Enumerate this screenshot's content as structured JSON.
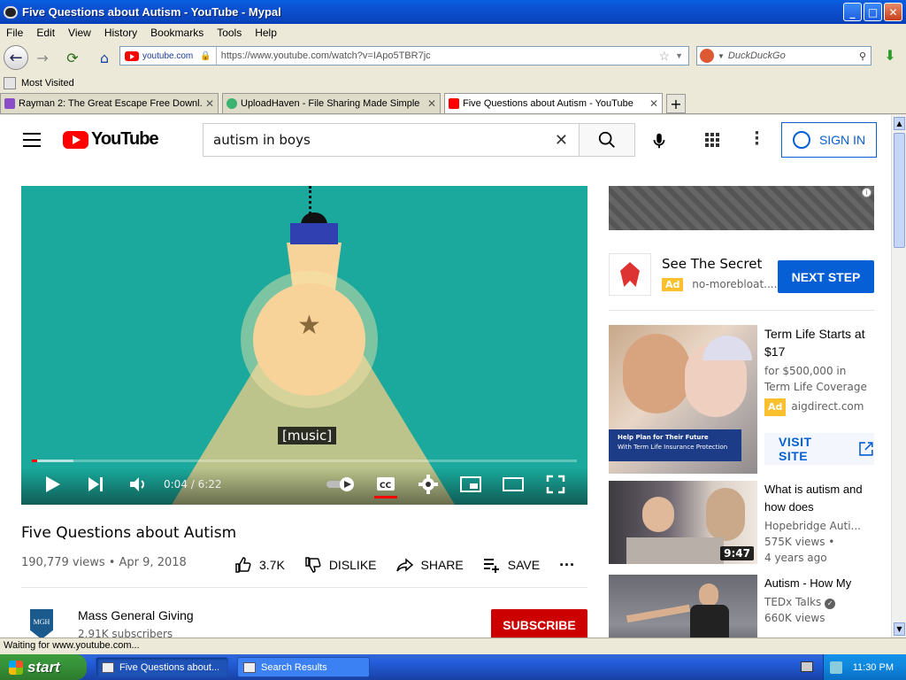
{
  "window": {
    "title": "Five Questions about Autism - YouTube - Mypal",
    "controls": {
      "minimize": "_",
      "maximize": "□",
      "close": "✕"
    }
  },
  "menu": [
    "File",
    "Edit",
    "View",
    "History",
    "Bookmarks",
    "Tools",
    "Help"
  ],
  "navbar": {
    "site_identity": "youtube.com",
    "url": "https://www.youtube.com/watch?v=IApo5TBR7jc",
    "search_placeholder": "DuckDuckGo"
  },
  "bookmarks": {
    "most_visited": "Most Visited"
  },
  "tabs": [
    {
      "label": "Rayman 2: The Great Escape Free Downl...",
      "favicon_color": "#8b4cc8"
    },
    {
      "label": "UploadHaven - File Sharing Made Simple",
      "favicon_color": "#3cb371"
    },
    {
      "label": "Five Questions about Autism - YouTube",
      "favicon_color": "#ff0000",
      "active": true
    }
  ],
  "youtube": {
    "logo_text": "YouTube",
    "search_query": "autism in boys",
    "sign_in": "SIGN IN",
    "player": {
      "caption": "[music]",
      "time": "0:04 / 6:22",
      "progress_fraction": 0.0105,
      "buffered_fraction": 0.077
    },
    "video": {
      "title": "Five Questions about Autism",
      "stats": "190,779 views • Apr 9, 2018",
      "likes": "3.7K",
      "dislike": "DISLIKE",
      "share": "SHARE",
      "save": "SAVE"
    },
    "channel": {
      "name": "Mass General Giving",
      "subscribers": "2.91K subscribers",
      "avatar_text": "MGH",
      "subscribe": "SUBSCRIBE"
    },
    "ad": {
      "title": "See The Secret",
      "badge": "Ad",
      "domain": "no-morebloat....",
      "cta": "NEXT STEP"
    },
    "recommendations": [
      {
        "title": "Term Life Starts at $17",
        "line1": "for $500,000 in Term Life Coverage",
        "badge": "Ad",
        "line2": "aigdirect.com",
        "cta": "VISIT SITE",
        "thumb_caption_1": "Help Plan for Their Future",
        "thumb_caption_2": "With Term Life Insurance Protection"
      },
      {
        "title": "What is autism and how does",
        "channel": "Hopebridge Auti...",
        "views": "575K views •",
        "age": "4 years ago",
        "duration": "9:47"
      },
      {
        "title": "Autism - How My",
        "channel": "TEDx Talks",
        "views": "660K views"
      }
    ]
  },
  "status": "Waiting for www.youtube.com...",
  "taskbar": {
    "start": "start",
    "tasks": [
      "Five Questions about...",
      "Search Results"
    ],
    "clock": "11:30 PM"
  }
}
